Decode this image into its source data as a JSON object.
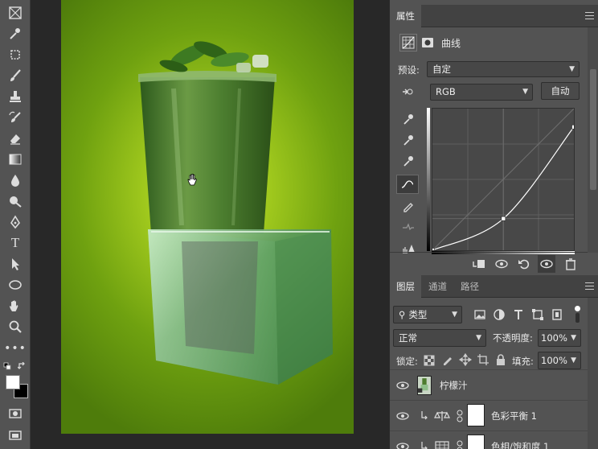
{
  "tools": [
    {
      "name": "slice-icon"
    },
    {
      "name": "eyedropper-icon"
    },
    {
      "name": "crop-icon"
    },
    {
      "name": "brush-icon"
    },
    {
      "name": "stamp-icon"
    },
    {
      "name": "history-brush-icon"
    },
    {
      "name": "eraser-icon"
    },
    {
      "name": "gradient-icon"
    },
    {
      "name": "blur-icon"
    },
    {
      "name": "dodge-icon"
    },
    {
      "name": "pen-icon"
    },
    {
      "name": "type-icon"
    },
    {
      "name": "path-select-icon"
    },
    {
      "name": "ellipse-icon"
    },
    {
      "name": "hand-icon"
    },
    {
      "name": "zoom-icon"
    }
  ],
  "toolbar": {
    "more": "•••",
    "type_label": "T"
  },
  "colors": {
    "foreground": "#ffffff",
    "background": "#000000"
  },
  "properties": {
    "tab": "属性",
    "adjustment_title": "曲线",
    "preset_label": "预设:",
    "preset_value": "自定",
    "channel_value": "RGB",
    "auto_button": "自动"
  },
  "curve": {
    "points": [
      [
        0,
        0
      ],
      [
        128,
        57
      ],
      [
        255,
        222
      ]
    ]
  },
  "layers_panel": {
    "tabs": [
      "图层",
      "通道",
      "路径"
    ],
    "filter_kind": "类型",
    "blend_mode": "正常",
    "opacity_label": "不透明度:",
    "opacity_value": "100%",
    "lock_label": "锁定:",
    "fill_label": "填充:",
    "fill_value": "100%",
    "layers": [
      {
        "name": "柠檬汁",
        "type": "smart"
      },
      {
        "name": "色彩平衡 1",
        "type": "adjustment"
      },
      {
        "name": "色相/饱和度 1",
        "type": "adjustment"
      }
    ]
  }
}
